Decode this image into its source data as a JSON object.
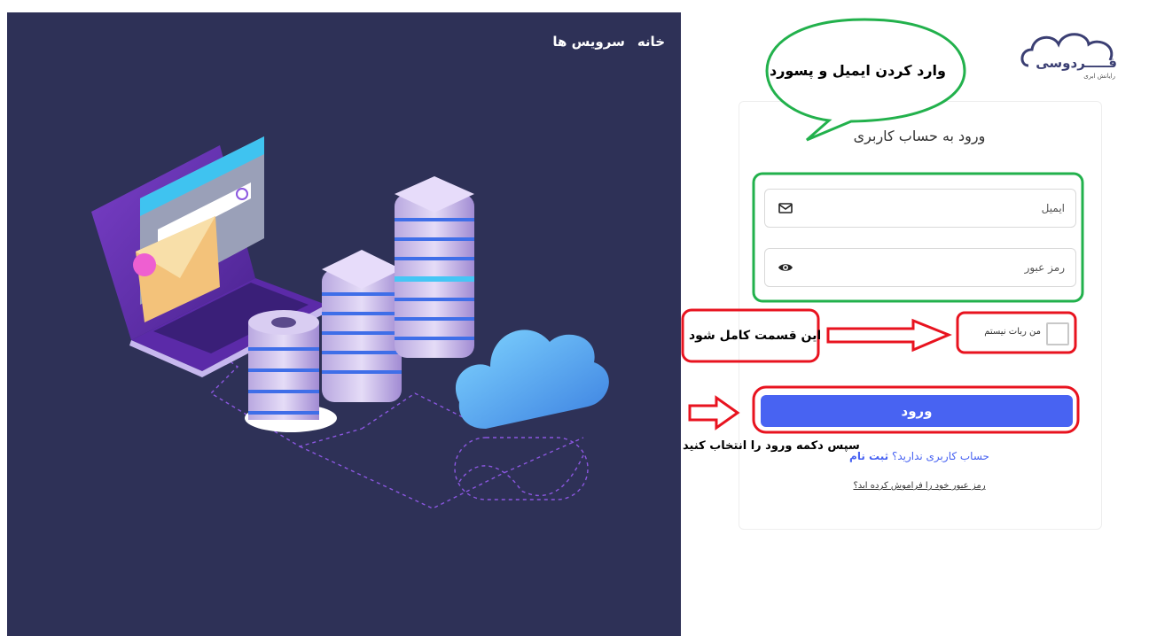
{
  "nav": {
    "home": "خانه",
    "services": "سرویس ها"
  },
  "logo": {
    "name": "فـــــردوسی",
    "tagline": "رایانش ابری"
  },
  "login": {
    "title": "ورود به حساب کاربری",
    "email_placeholder": "ایمیل",
    "password_placeholder": "رمز عبور",
    "captcha_label": "من ربات نیستم",
    "submit_label": "ورود",
    "no_account_text": "حساب کاربری ندارید؟",
    "signup_link": "ثبت نام",
    "forgot_link": "رمز عبور خود را فراموش کرده اید؟"
  },
  "annotations": {
    "enter_credentials": "وارد کردن ایمیل و پسورد",
    "complete_section": "این قسمت کامل شود",
    "then_click": "سپس دکمه ورود را انتخاب کنید"
  },
  "colors": {
    "hero_bg": "#2e3157",
    "primary": "#4863f2",
    "annotation_green": "#22b14c",
    "annotation_red": "#e8131f"
  },
  "icons": [
    "mail-icon",
    "eye-icon",
    "cloud-logo-icon",
    "arrow-right-icon"
  ]
}
